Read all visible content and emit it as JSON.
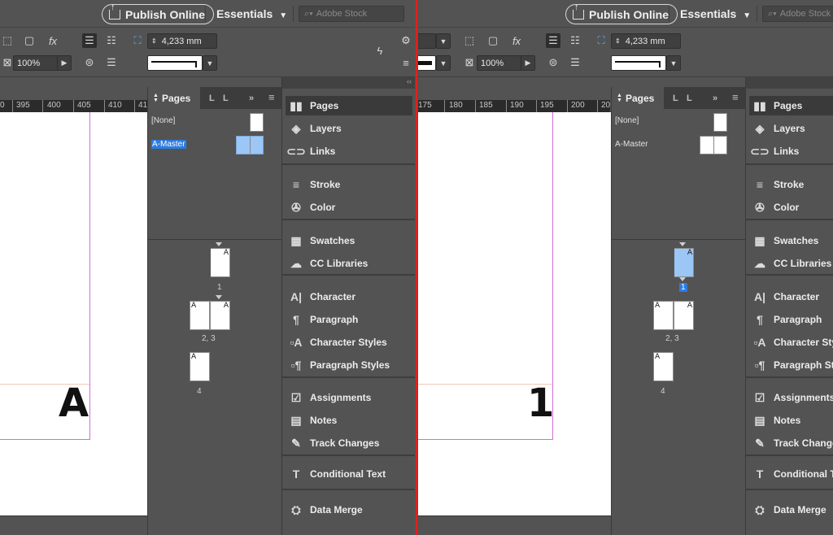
{
  "topbar": {
    "publish_label": "Publish Online",
    "workspace_label": "Essentials",
    "stock_placeholder": "Adobe Stock"
  },
  "control": {
    "stroke_weight": "4,233 mm",
    "zoom": "100%"
  },
  "left": {
    "ruler": [
      "0",
      "395",
      "400",
      "405",
      "410",
      "41"
    ],
    "big_letter": "A"
  },
  "right": {
    "ruler": [
      "175",
      "180",
      "185",
      "190",
      "195",
      "200",
      "20"
    ],
    "big_letter": "1"
  },
  "pages_panel": {
    "tab": "Pages",
    "mini_tabs": [
      "L",
      "L",
      "»"
    ],
    "masters": [
      "[None]",
      "A-Master"
    ],
    "page_labels": [
      "1",
      "2, 3",
      "4"
    ],
    "master_prefix": "A"
  },
  "dock": {
    "groups": [
      [
        "Pages",
        "Layers",
        "Links"
      ],
      [
        "Stroke",
        "Color"
      ],
      [
        "Swatches",
        "CC Libraries"
      ],
      [
        "Character",
        "Paragraph",
        "Character Styles",
        "Paragraph Styles"
      ],
      [
        "Assignments",
        "Notes",
        "Track Changes"
      ],
      [
        "Conditional Text"
      ],
      [
        "Data Merge"
      ]
    ],
    "icons": [
      [
        "pages-icon",
        "layers-icon",
        "links-icon"
      ],
      [
        "stroke-icon",
        "color-icon"
      ],
      [
        "swatches-icon",
        "cc-libraries-icon"
      ],
      [
        "character-icon",
        "paragraph-icon",
        "character-styles-icon",
        "paragraph-styles-icon"
      ],
      [
        "assignments-icon",
        "notes-icon",
        "track-changes-icon"
      ],
      [
        "conditional-text-icon"
      ],
      [
        "data-merge-icon"
      ]
    ]
  },
  "colors": {
    "selection": "#2c7ce0",
    "divider": "#e02020",
    "margin": "#d070d8"
  }
}
